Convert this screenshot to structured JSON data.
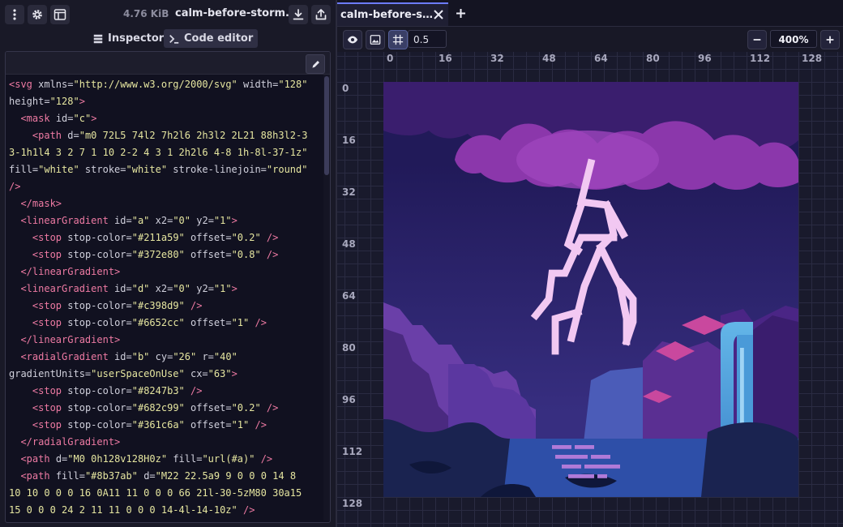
{
  "file": {
    "size": "4.76 KiB",
    "name": "calm-before-storm...."
  },
  "left_tabs": {
    "inspector": "Inspector",
    "code_editor": "Code editor"
  },
  "code_lines": [
    [
      [
        "tag",
        "<svg "
      ],
      [
        "attr",
        "xmlns="
      ],
      [
        "str",
        "\"http://www.w3.org/2000/svg\""
      ],
      [
        "attr",
        " width="
      ],
      [
        "str",
        "\"128\""
      ]
    ],
    [
      [
        "attr",
        "height="
      ],
      [
        "str",
        "\"128\""
      ],
      [
        "tag",
        ">"
      ]
    ],
    [
      [
        "txt",
        "  "
      ],
      [
        "tag",
        "<mask "
      ],
      [
        "attr",
        "id="
      ],
      [
        "str",
        "\"c\""
      ],
      [
        "tag",
        ">"
      ]
    ],
    [
      [
        "txt",
        "    "
      ],
      [
        "tag",
        "<path "
      ],
      [
        "attr",
        "d="
      ],
      [
        "str",
        "\"m0 72L5 74l2 7h2l6 2h3l2 2L21 88h3l2-3"
      ]
    ],
    [
      [
        "str",
        "3-1h1l4 3 2 7 1 10 2-2 4 3 1 2h2l6 4-8 1h-8l-37-1z\""
      ]
    ],
    [
      [
        "attr",
        "fill="
      ],
      [
        "str",
        "\"white\""
      ],
      [
        "attr",
        " stroke="
      ],
      [
        "str",
        "\"white\""
      ],
      [
        "attr",
        " stroke-linejoin="
      ],
      [
        "str",
        "\"round\""
      ]
    ],
    [
      [
        "tag",
        "/>"
      ]
    ],
    [
      [
        "txt",
        "  "
      ],
      [
        "tag",
        "</mask>"
      ]
    ],
    [
      [
        "txt",
        "  "
      ],
      [
        "tag",
        "<linearGradient "
      ],
      [
        "attr",
        "id="
      ],
      [
        "str",
        "\"a\""
      ],
      [
        "attr",
        " x2="
      ],
      [
        "str",
        "\"0\""
      ],
      [
        "attr",
        " y2="
      ],
      [
        "str",
        "\"1\""
      ],
      [
        "tag",
        ">"
      ]
    ],
    [
      [
        "txt",
        "    "
      ],
      [
        "tag",
        "<stop "
      ],
      [
        "attr",
        "stop-color="
      ],
      [
        "str",
        "\"#211a59\""
      ],
      [
        "attr",
        " offset="
      ],
      [
        "str",
        "\"0.2\""
      ],
      [
        "tag",
        " />"
      ]
    ],
    [
      [
        "txt",
        "    "
      ],
      [
        "tag",
        "<stop "
      ],
      [
        "attr",
        "stop-color="
      ],
      [
        "str",
        "\"#372e80\""
      ],
      [
        "attr",
        " offset="
      ],
      [
        "str",
        "\"0.8\""
      ],
      [
        "tag",
        " />"
      ]
    ],
    [
      [
        "txt",
        "  "
      ],
      [
        "tag",
        "</linearGradient>"
      ]
    ],
    [
      [
        "txt",
        "  "
      ],
      [
        "tag",
        "<linearGradient "
      ],
      [
        "attr",
        "id="
      ],
      [
        "str",
        "\"d\""
      ],
      [
        "attr",
        " x2="
      ],
      [
        "str",
        "\"0\""
      ],
      [
        "attr",
        " y2="
      ],
      [
        "str",
        "\"1\""
      ],
      [
        "tag",
        ">"
      ]
    ],
    [
      [
        "txt",
        "    "
      ],
      [
        "tag",
        "<stop "
      ],
      [
        "attr",
        "stop-color="
      ],
      [
        "str",
        "\"#c398d9\""
      ],
      [
        "tag",
        " />"
      ]
    ],
    [
      [
        "txt",
        "    "
      ],
      [
        "tag",
        "<stop "
      ],
      [
        "attr",
        "stop-color="
      ],
      [
        "str",
        "\"#6652cc\""
      ],
      [
        "attr",
        " offset="
      ],
      [
        "str",
        "\"1\""
      ],
      [
        "tag",
        " />"
      ]
    ],
    [
      [
        "txt",
        "  "
      ],
      [
        "tag",
        "</linearGradient>"
      ]
    ],
    [
      [
        "txt",
        "  "
      ],
      [
        "tag",
        "<radialGradient "
      ],
      [
        "attr",
        "id="
      ],
      [
        "str",
        "\"b\""
      ],
      [
        "attr",
        " cy="
      ],
      [
        "str",
        "\"26\""
      ],
      [
        "attr",
        " r="
      ],
      [
        "str",
        "\"40\""
      ]
    ],
    [
      [
        "attr",
        "gradientUnits="
      ],
      [
        "str",
        "\"userSpaceOnUse\""
      ],
      [
        "attr",
        " cx="
      ],
      [
        "str",
        "\"63\""
      ],
      [
        "tag",
        ">"
      ]
    ],
    [
      [
        "txt",
        "    "
      ],
      [
        "tag",
        "<stop "
      ],
      [
        "attr",
        "stop-color="
      ],
      [
        "str",
        "\"#8247b3\""
      ],
      [
        "tag",
        " />"
      ]
    ],
    [
      [
        "txt",
        "    "
      ],
      [
        "tag",
        "<stop "
      ],
      [
        "attr",
        "stop-color="
      ],
      [
        "str",
        "\"#682c99\""
      ],
      [
        "attr",
        " offset="
      ],
      [
        "str",
        "\"0.2\""
      ],
      [
        "tag",
        " />"
      ]
    ],
    [
      [
        "txt",
        "    "
      ],
      [
        "tag",
        "<stop "
      ],
      [
        "attr",
        "stop-color="
      ],
      [
        "str",
        "\"#361c6a\""
      ],
      [
        "attr",
        " offset="
      ],
      [
        "str",
        "\"1\""
      ],
      [
        "tag",
        " />"
      ]
    ],
    [
      [
        "txt",
        "  "
      ],
      [
        "tag",
        "</radialGradient>"
      ]
    ],
    [
      [
        "txt",
        "  "
      ],
      [
        "tag",
        "<path "
      ],
      [
        "attr",
        "d="
      ],
      [
        "str",
        "\"M0 0h128v128H0z\""
      ],
      [
        "attr",
        " fill="
      ],
      [
        "str",
        "\"url(#a)\""
      ],
      [
        "tag",
        " />"
      ]
    ],
    [
      [
        "txt",
        "  "
      ],
      [
        "tag",
        "<path "
      ],
      [
        "attr",
        "fill="
      ],
      [
        "str",
        "\"#8b37ab\""
      ],
      [
        "attr",
        " d="
      ],
      [
        "str",
        "\"M22 22.5a9 9 0 0 0 14 8"
      ]
    ],
    [
      [
        "str",
        "10 10 0 0 0 16 0A11 11 0 0 0 66 21l-30-5zM80 30a15"
      ]
    ],
    [
      [
        "str",
        "15 0 0 0 24 2 11 11 0 0 0 14-4l-14-10z\""
      ],
      [
        "tag",
        " />"
      ]
    ]
  ],
  "document_tab": {
    "title": "calm-before-storm.svg"
  },
  "toolbar": {
    "grid_value": "0.5",
    "zoom": "400%"
  },
  "ruler_top": [
    "0",
    "16",
    "32",
    "48",
    "64",
    "80",
    "96",
    "112",
    "128"
  ],
  "ruler_left": [
    "0",
    "16",
    "32",
    "48",
    "64",
    "80",
    "96",
    "112",
    "128"
  ],
  "icons": {
    "menu": "vertical-dots-icon",
    "settings": "gear-icon",
    "layout": "panel-layout-icon",
    "download": "download-icon",
    "share": "share-icon",
    "inspector": "layers-icon",
    "code": "terminal-icon",
    "edit": "pencil-icon",
    "close": "close-icon",
    "add": "plus-icon",
    "eye": "eye-icon",
    "image": "image-icon",
    "grid": "grid-snap-icon",
    "zoom_out": "minus-icon",
    "zoom_in": "plus-icon"
  },
  "colors": {
    "accent": "#6c7cff",
    "tag": "#ee7aa3",
    "string": "#e6e6a0",
    "code_text": "#b8f0d8",
    "sky_top": "#211a59",
    "sky_bottom": "#372e80",
    "lightning": "#f2c8f2",
    "cloud": "#8b37ab",
    "waterfall": "#4a9ad8",
    "water": "#2e4fa8"
  }
}
